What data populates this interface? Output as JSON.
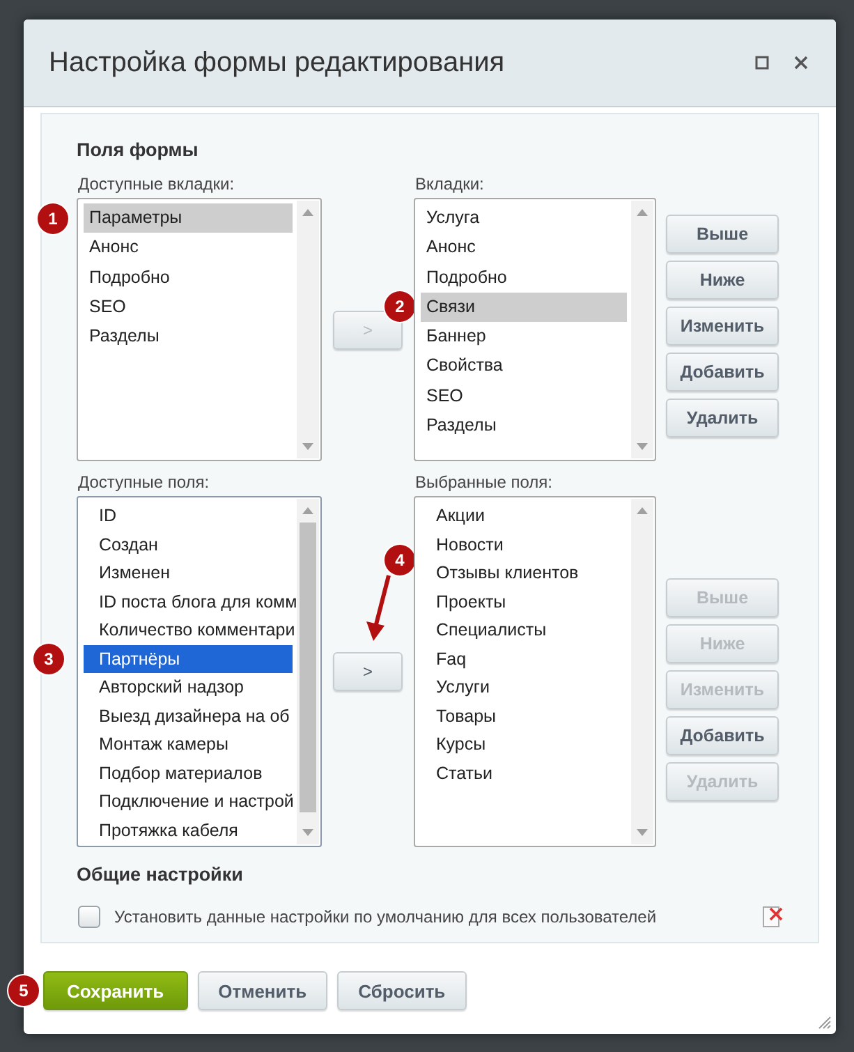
{
  "dialog": {
    "title": "Настройка формы редактирования",
    "form_fields": {
      "heading": "Поля формы",
      "available_tabs": {
        "label": "Доступные вкладки:",
        "focused": false,
        "items": [
          {
            "text": "Параметры",
            "selected": true,
            "badge": "1"
          },
          {
            "text": "Анонс",
            "selected": false
          },
          {
            "text": "Подробно",
            "selected": false
          },
          {
            "text": "SEO",
            "selected": false
          },
          {
            "text": "Разделы",
            "selected": false
          }
        ]
      },
      "move_tab_button": {
        "label": ">",
        "disabled": true
      },
      "tabs": {
        "label": "Вкладки:",
        "focused": false,
        "items": [
          {
            "text": "Услуга",
            "selected": false
          },
          {
            "text": "Анонс",
            "selected": false
          },
          {
            "text": "Подробно",
            "selected": false
          },
          {
            "text": "Связи",
            "selected": true,
            "badge": "2"
          },
          {
            "text": "Баннер",
            "selected": false
          },
          {
            "text": "Свойства",
            "selected": false
          },
          {
            "text": "SEO",
            "selected": false
          },
          {
            "text": "Разделы",
            "selected": false
          }
        ]
      },
      "tab_buttons": [
        {
          "label": "Выше",
          "disabled": false
        },
        {
          "label": "Ниже",
          "disabled": false
        },
        {
          "label": "Изменить",
          "disabled": false
        },
        {
          "label": "Добавить",
          "disabled": false
        },
        {
          "label": "Удалить",
          "disabled": false
        }
      ],
      "available_fields": {
        "label": "Доступные поля:",
        "focused": true,
        "items": [
          {
            "text": "ID",
            "selected": false
          },
          {
            "text": "Создан",
            "selected": false
          },
          {
            "text": "Изменен",
            "selected": false
          },
          {
            "text": "ID поста блога для комм",
            "selected": false
          },
          {
            "text": "Количество комментари",
            "selected": false
          },
          {
            "text": "Партнёры",
            "selected": true,
            "badge": "3"
          },
          {
            "text": "Авторский надзор",
            "selected": false
          },
          {
            "text": "Выезд дизайнера на об",
            "selected": false
          },
          {
            "text": "Монтаж камеры",
            "selected": false
          },
          {
            "text": "Подбор материалов",
            "selected": false
          },
          {
            "text": "Подключение и настрой",
            "selected": false
          },
          {
            "text": "Протяжка кабеля",
            "selected": false
          }
        ]
      },
      "move_field_button": {
        "label": ">",
        "disabled": false,
        "badge": "4"
      },
      "selected_fields": {
        "label": "Выбранные поля:",
        "focused": false,
        "items": [
          {
            "text": "Акции",
            "selected": false
          },
          {
            "text": "Новости",
            "selected": false
          },
          {
            "text": "Отзывы клиентов",
            "selected": false
          },
          {
            "text": "Проекты",
            "selected": false
          },
          {
            "text": "Специалисты",
            "selected": false
          },
          {
            "text": "Faq",
            "selected": false
          },
          {
            "text": "Услуги",
            "selected": false
          },
          {
            "text": "Товары",
            "selected": false
          },
          {
            "text": "Курсы",
            "selected": false
          },
          {
            "text": "Статьи",
            "selected": false
          }
        ]
      },
      "field_buttons": [
        {
          "label": "Выше",
          "disabled": true
        },
        {
          "label": "Ниже",
          "disabled": true
        },
        {
          "label": "Изменить",
          "disabled": true
        },
        {
          "label": "Добавить",
          "disabled": false
        },
        {
          "label": "Удалить",
          "disabled": true
        }
      ]
    },
    "general": {
      "heading": "Общие настройки",
      "checkbox": {
        "label": "Установить данные настройки по умолчанию для всех пользователей",
        "checked": false
      }
    },
    "buttons": [
      {
        "label": "Сохранить",
        "kind": "primary",
        "badge": "5"
      },
      {
        "label": "Отменить",
        "kind": "normal"
      },
      {
        "label": "Сбросить",
        "kind": "normal"
      }
    ]
  }
}
